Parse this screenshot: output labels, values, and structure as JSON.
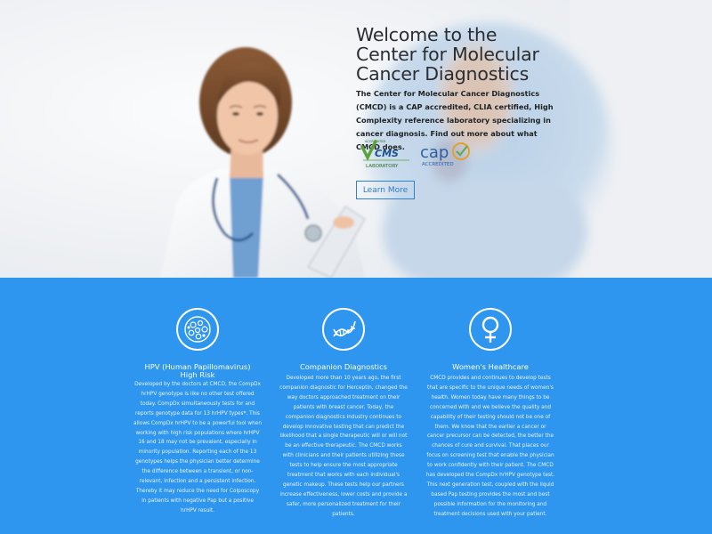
{
  "hero": {
    "title": "Welcome to the Center for Molecular Cancer Diagnostics",
    "description": "The Center for Molecular Cancer Diagnostics (CMCD) is a CAP accredited, CLIA certified, High Complexity reference laboratory specializing in cancer diagnosis. Find out more about what CMCD does.",
    "cms_badge": {
      "top": "ACCREDITED",
      "brand": "CMS",
      "bottom": "LABORATORY"
    },
    "cap_badge": {
      "brand": "cap",
      "bottom": "ACCREDITED"
    },
    "learn_more_label": "Learn More"
  },
  "features": [
    {
      "icon": "cells-icon",
      "title": "HPV (Human Papillomavirus) High Risk",
      "body": "Developed by the doctors at CMCD, the CompDx hrHPV genotype is like no other test offered today. CompDx simultaneously tests for and reports genotype data for 13 hrHPV types*. This allows CompDx hrHPV to be a powerful tool when working with high risk populations where hrHPV 16 and 18 may not be prevalent, especially in minority population. Reporting each of the 13 genotypes helps the physician better determine the difference between a transient, or non-relevant, infection and a persistent infection. Thereby it may reduce the need for Colposcopy in patients with negative Pap but a positive hrHPV result."
    },
    {
      "icon": "dna-icon",
      "title": "Companion Diagnostics",
      "body": "Developed more than 10 years ago, the first companion diagnostic for Herceptin, changed the way doctors approached treatment on their patients with breast cancer. Today, the companion diagnostics industry continues to develop innovative testing that can predict the likelihood that a single therapeutic will or will not be an effective therapeutic. The CMCD works with clinicians and their patients utilizing these tests to help ensure the most appropriate treatment that works with each individual's genetic makeup. These tests help our partners increase effectiveness, lower costs and provide a safer, more personalized treatment for their patients."
    },
    {
      "icon": "female-symbol-icon",
      "title": "Women's Healthcare",
      "body": "CMCD provides and continues to develop tests that are specific to the unique needs of women's health. Women today have many things to be concerned with and we believe the quality and capability of their testing should not be one of them. We know that the earlier a cancer or cancer precursor can be detected, the better the chances of cure and survival. That places our focus on screening test that enable the physician to work confidently with their patient. The CMCD has developed the CompDx hrHPV genotype test. This next generation test, coupled with the liquid based Pap testing provides the most and best possible information for the monitoring and treatment decisions used with your patient."
    }
  ]
}
